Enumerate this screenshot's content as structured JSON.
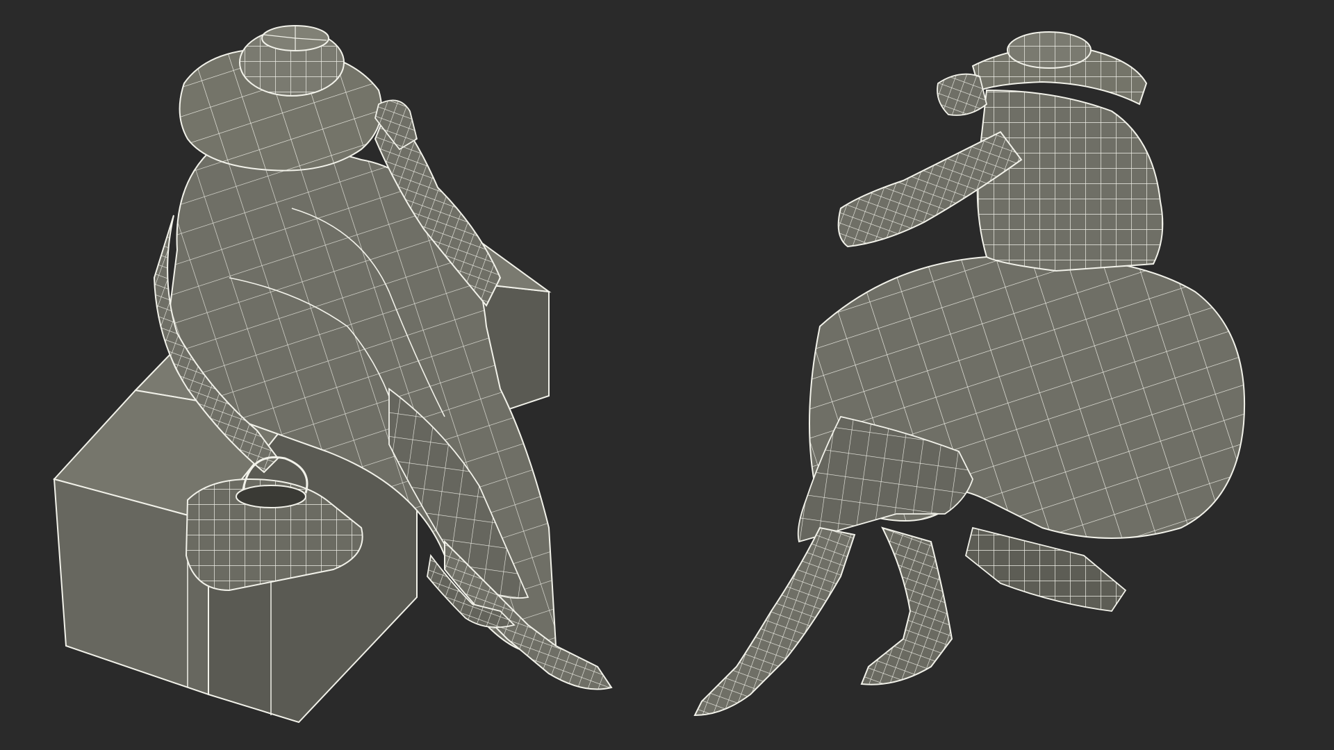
{
  "scene": {
    "background_color": "#2a2a2a",
    "mesh_fill_color": "#6f6f66",
    "mesh_shade_color": "#5d5d55",
    "mesh_dark_color": "#4e4e47",
    "wire_color": "#f2f2ea",
    "views": [
      {
        "name": "view-top-seated-on-box",
        "subject": "seated-woman-wireframe"
      },
      {
        "name": "view-rear-low-angle",
        "subject": "seated-woman-wireframe"
      }
    ]
  }
}
